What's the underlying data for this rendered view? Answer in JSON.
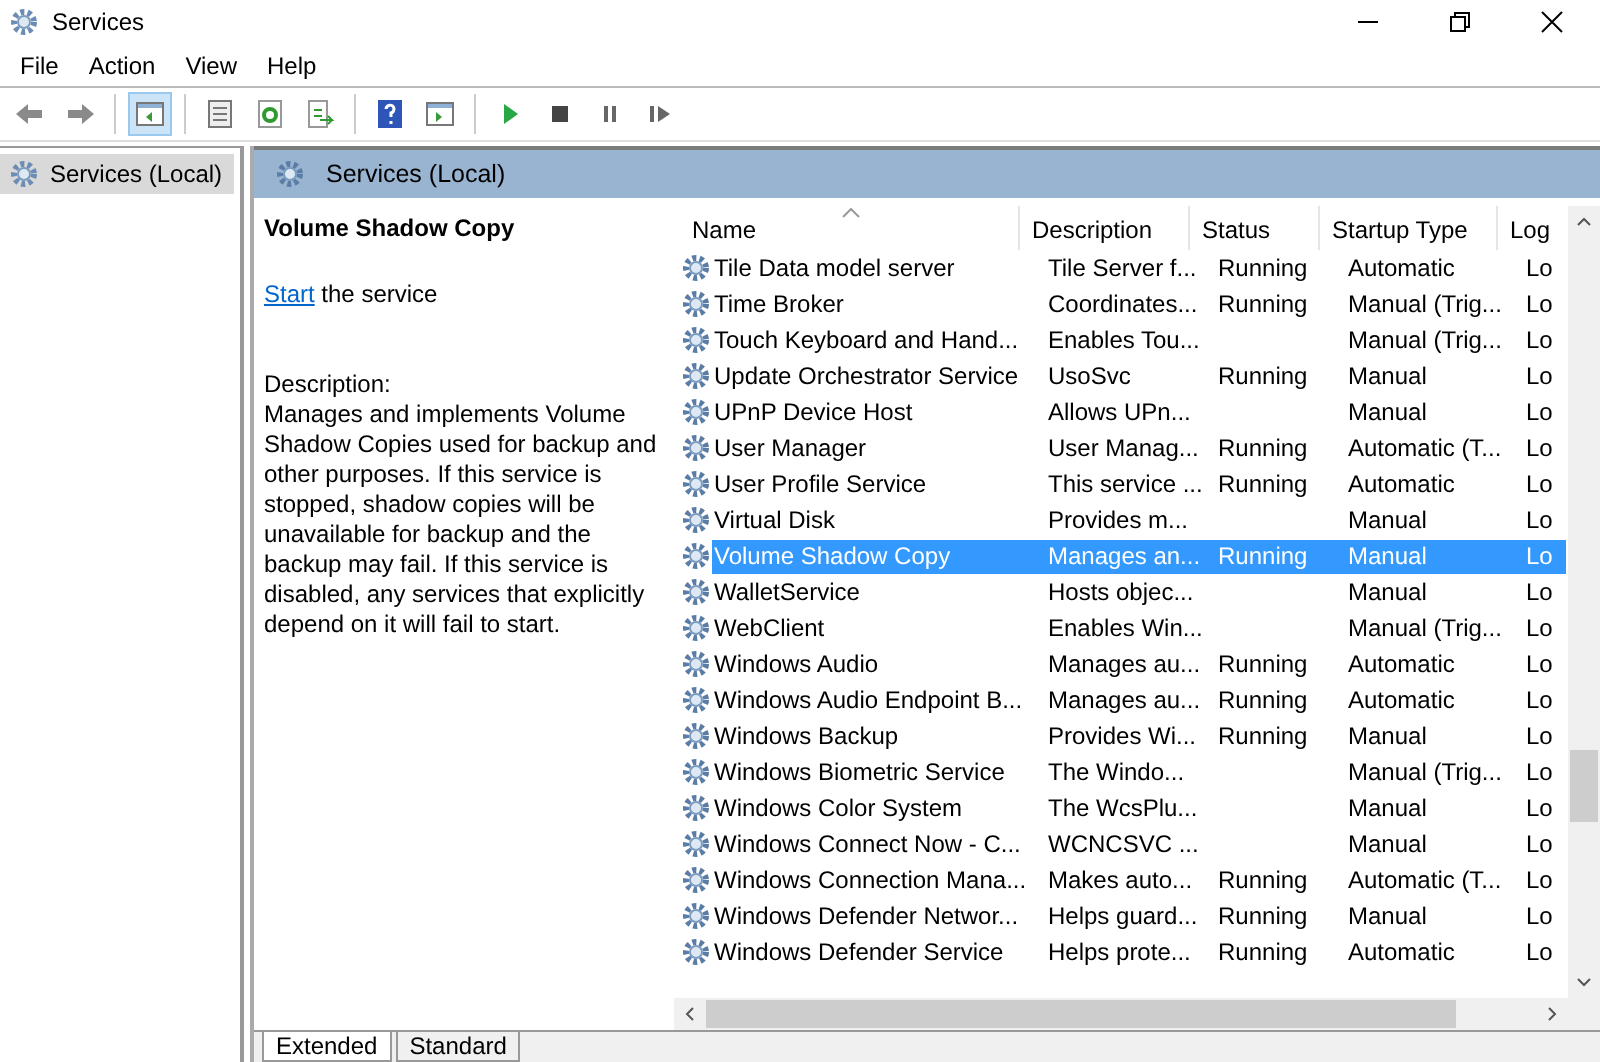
{
  "window": {
    "title": "Services"
  },
  "menu": [
    "File",
    "Action",
    "View",
    "Help"
  ],
  "toolbar": [
    {
      "kind": "back",
      "selected": false
    },
    {
      "kind": "forward",
      "selected": false
    },
    {
      "kind": "tree",
      "selected": true
    },
    {
      "kind": "properties",
      "selected": false
    },
    {
      "kind": "refresh",
      "selected": false
    },
    {
      "kind": "export",
      "selected": false
    },
    {
      "kind": "help",
      "selected": false
    },
    {
      "kind": "pane",
      "selected": false
    },
    {
      "kind": "play",
      "selected": false
    },
    {
      "kind": "stop",
      "selected": false
    },
    {
      "kind": "pause",
      "selected": false
    },
    {
      "kind": "resume",
      "selected": false
    }
  ],
  "tree": {
    "items": [
      {
        "label": "Services (Local)",
        "selected": true
      }
    ]
  },
  "panel_header": "Services (Local)",
  "details": {
    "title": "Volume Shadow Copy",
    "link": "Start",
    "link_rest": " the service",
    "description_label": "Description:",
    "description": "Manages and implements Volume Shadow Copies used for backup and other purposes. If this service is stopped, shadow copies will be unavailable for backup and the backup may fail. If this service is disabled, any services that explicitly depend on it will fail to start."
  },
  "table": {
    "columns": [
      "Name",
      "Description",
      "Status",
      "Startup Type",
      "Log"
    ],
    "rows": [
      {
        "name": "Tile Data model server",
        "description": "Tile Server f...",
        "status": "Running",
        "startup": "Automatic",
        "column_5": "Lo",
        "selected": false
      },
      {
        "name": "Time Broker",
        "description": "Coordinates...",
        "status": "Running",
        "startup": "Manual (Trig...",
        "column_5": "Lo",
        "selected": false
      },
      {
        "name": "Touch Keyboard and Hand...",
        "description": "Enables Tou...",
        "status": "",
        "startup": "Manual (Trig...",
        "column_5": "Lo",
        "selected": false
      },
      {
        "name": "Update Orchestrator Service",
        "description": "UsoSvc",
        "status": "Running",
        "startup": "Manual",
        "column_5": "Lo",
        "selected": false
      },
      {
        "name": "UPnP Device Host",
        "description": "Allows UPn...",
        "status": "",
        "startup": "Manual",
        "column_5": "Lo",
        "selected": false
      },
      {
        "name": "User Manager",
        "description": "User Manag...",
        "status": "Running",
        "startup": "Automatic (T...",
        "column_5": "Lo",
        "selected": false
      },
      {
        "name": "User Profile Service",
        "description": "This service ...",
        "status": "Running",
        "startup": "Automatic",
        "column_5": "Lo",
        "selected": false
      },
      {
        "name": "Virtual Disk",
        "description": "Provides m...",
        "status": "",
        "startup": "Manual",
        "column_5": "Lo",
        "selected": false
      },
      {
        "name": "Volume Shadow Copy",
        "description": "Manages an...",
        "status": "Running",
        "startup": "Manual",
        "column_5": "Lo",
        "selected": true
      },
      {
        "name": "WalletService",
        "description": "Hosts objec...",
        "status": "",
        "startup": "Manual",
        "column_5": "Lo",
        "selected": false
      },
      {
        "name": "WebClient",
        "description": "Enables Win...",
        "status": "",
        "startup": "Manual (Trig...",
        "column_5": "Lo",
        "selected": false
      },
      {
        "name": "Windows Audio",
        "description": "Manages au...",
        "status": "Running",
        "startup": "Automatic",
        "column_5": "Lo",
        "selected": false
      },
      {
        "name": "Windows Audio Endpoint B...",
        "description": "Manages au...",
        "status": "Running",
        "startup": "Automatic",
        "column_5": "Lo",
        "selected": false
      },
      {
        "name": "Windows Backup",
        "description": "Provides Wi...",
        "status": "Running",
        "startup": "Manual",
        "column_5": "Lo",
        "selected": false
      },
      {
        "name": "Windows Biometric Service",
        "description": "The Windo...",
        "status": "",
        "startup": "Manual (Trig...",
        "column_5": "Lo",
        "selected": false
      },
      {
        "name": "Windows Color System",
        "description": "The WcsPlu...",
        "status": "",
        "startup": "Manual",
        "column_5": "Lo",
        "selected": false
      },
      {
        "name": "Windows Connect Now - C...",
        "description": "WCNCSVC ...",
        "status": "",
        "startup": "Manual",
        "column_5": "Lo",
        "selected": false
      },
      {
        "name": "Windows Connection Mana...",
        "description": "Makes auto...",
        "status": "Running",
        "startup": "Automatic (T...",
        "column_5": "Lo",
        "selected": false
      },
      {
        "name": "Windows Defender Networ...",
        "description": "Helps guard...",
        "status": "Running",
        "startup": "Manual",
        "column_5": "Lo",
        "selected": false
      },
      {
        "name": "Windows Defender Service",
        "description": "Helps prote...",
        "status": "Running",
        "startup": "Automatic",
        "column_5": "Lo",
        "selected": false
      }
    ]
  },
  "bottom_tabs": [
    {
      "label": "Extended",
      "selected": true
    },
    {
      "label": "Standard",
      "selected": false
    }
  ]
}
